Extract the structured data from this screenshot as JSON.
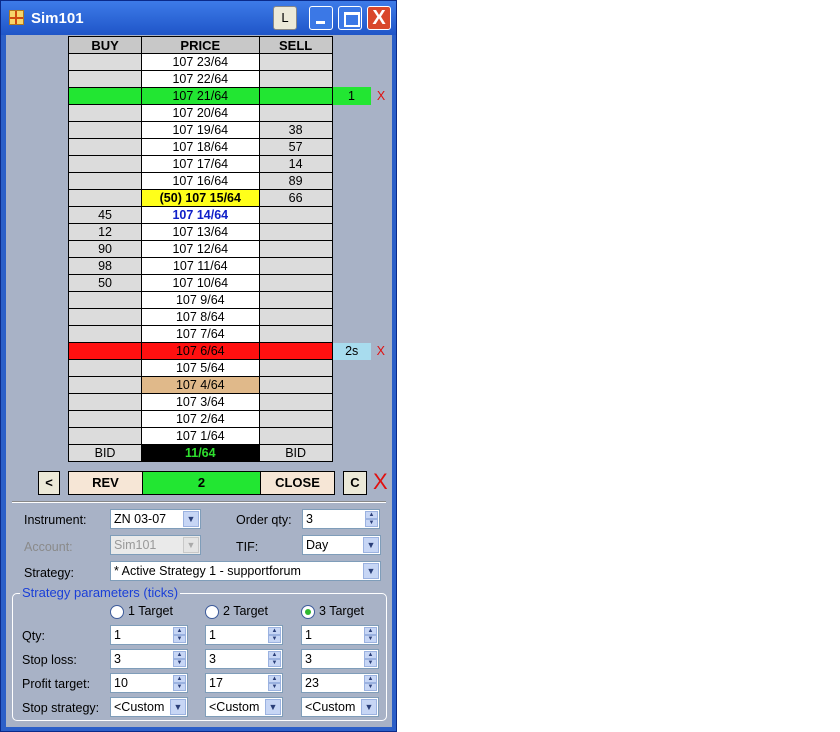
{
  "window": {
    "title": "Sim101",
    "l_button": "L",
    "close_glyph": "X"
  },
  "ladder": {
    "headers": {
      "buy": "BUY",
      "price": "PRICE",
      "sell": "SELL"
    },
    "rows": [
      {
        "buy": "",
        "price": "107 23/64",
        "sell": "",
        "order": "",
        "x": "",
        "style": ""
      },
      {
        "buy": "",
        "price": "107 22/64",
        "sell": "",
        "order": "",
        "x": "",
        "style": ""
      },
      {
        "buy": "",
        "price": "107 21/64",
        "sell": "",
        "order": "1",
        "x": "X",
        "style": "green"
      },
      {
        "buy": "",
        "price": "107 20/64",
        "sell": "",
        "order": "",
        "x": "",
        "style": ""
      },
      {
        "buy": "",
        "price": "107 19/64",
        "sell": "38",
        "order": "",
        "x": "",
        "style": ""
      },
      {
        "buy": "",
        "price": "107 18/64",
        "sell": "57",
        "order": "",
        "x": "",
        "style": ""
      },
      {
        "buy": "",
        "price": "107 17/64",
        "sell": "14",
        "order": "",
        "x": "",
        "style": ""
      },
      {
        "buy": "",
        "price": "107 16/64",
        "sell": "89",
        "order": "",
        "x": "",
        "style": ""
      },
      {
        "buy": "",
        "price": "(50) 107 15/64",
        "sell": "66",
        "order": "",
        "x": "",
        "style": "last"
      },
      {
        "buy": "45",
        "price": "107 14/64",
        "sell": "",
        "order": "",
        "x": "",
        "style": "bestbid"
      },
      {
        "buy": "12",
        "price": "107 13/64",
        "sell": "",
        "order": "",
        "x": "",
        "style": ""
      },
      {
        "buy": "90",
        "price": "107 12/64",
        "sell": "",
        "order": "",
        "x": "",
        "style": ""
      },
      {
        "buy": "98",
        "price": "107 11/64",
        "sell": "",
        "order": "",
        "x": "",
        "style": ""
      },
      {
        "buy": "50",
        "price": "107 10/64",
        "sell": "",
        "order": "",
        "x": "",
        "style": ""
      },
      {
        "buy": "",
        "price": "107  9/64",
        "sell": "",
        "order": "",
        "x": "",
        "style": ""
      },
      {
        "buy": "",
        "price": "107  8/64",
        "sell": "",
        "order": "",
        "x": "",
        "style": ""
      },
      {
        "buy": "",
        "price": "107  7/64",
        "sell": "",
        "order": "",
        "x": "",
        "style": ""
      },
      {
        "buy": "",
        "price": "107  6/64",
        "sell": "",
        "order": "2s",
        "x": "X",
        "style": "red"
      },
      {
        "buy": "",
        "price": "107  5/64",
        "sell": "",
        "order": "",
        "x": "",
        "style": ""
      },
      {
        "buy": "",
        "price": "107  4/64",
        "sell": "",
        "order": "",
        "x": "",
        "style": "tan"
      },
      {
        "buy": "",
        "price": "107  3/64",
        "sell": "",
        "order": "",
        "x": "",
        "style": ""
      },
      {
        "buy": "",
        "price": "107  2/64",
        "sell": "",
        "order": "",
        "x": "",
        "style": ""
      },
      {
        "buy": "",
        "price": "107  1/64",
        "sell": "",
        "order": "",
        "x": "",
        "style": ""
      }
    ],
    "footer": {
      "buy": "BID",
      "price": "11/64",
      "sell": "BID"
    }
  },
  "actions": {
    "prev": "<",
    "rev": "REV",
    "position": "2",
    "close": "CLOSE",
    "c": "C",
    "cancel_all": "X"
  },
  "form": {
    "instrument_label": "Instrument:",
    "instrument_value": "ZN 03-07",
    "order_qty_label": "Order qty:",
    "order_qty_value": "3",
    "account_label": "Account:",
    "account_value": "Sim101",
    "tif_label": "TIF:",
    "tif_value": "Day",
    "strategy_label": "Strategy:",
    "strategy_value": "* Active Strategy 1 - supportforum"
  },
  "strategy_params": {
    "title": "Strategy parameters (ticks)",
    "targets": [
      "1 Target",
      "2 Target",
      "3 Target"
    ],
    "selected_target": "3 Target",
    "qty_label": "Qty:",
    "qty": [
      "1",
      "1",
      "1"
    ],
    "stop_loss_label": "Stop loss:",
    "stop_loss": [
      "3",
      "3",
      "3"
    ],
    "profit_target_label": "Profit target:",
    "profit_target": [
      "10",
      "17",
      "23"
    ],
    "stop_strategy_label": "Stop strategy:",
    "stop_strategy": [
      "<Custom",
      "<Custom",
      "<Custom"
    ]
  },
  "colors": {
    "buy_sell_cell": "#dcdcdc",
    "working_target": "#22e632",
    "working_stop": "#ff1010",
    "last_price": "#ffff1a",
    "best_bid_text": "#1020c8",
    "position_bar": "#22e632",
    "group_title": "#1a3fd8"
  }
}
